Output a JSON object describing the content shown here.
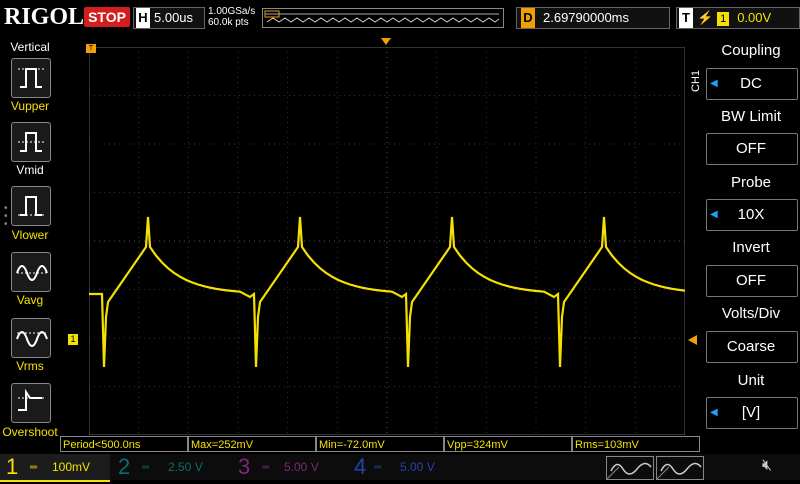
{
  "header": {
    "logo": "RIGOL",
    "status": "STOP",
    "horizontal_label": "H",
    "timebase": "5.00us",
    "sample_rate": "1.00GSa/s",
    "points": "60.0k pts",
    "delay_label": "D",
    "delay": "2.69790000ms",
    "trigger_label": "T",
    "trigger_edge_icon": "rising-edge-icon",
    "trigger_source": "1",
    "trigger_level": "0.00V"
  },
  "left_panel": {
    "title": "Vertical",
    "items": [
      {
        "label": "Vupper",
        "icon": "vupper-icon"
      },
      {
        "label": "Vmid",
        "icon": "vmid-icon"
      },
      {
        "label": "Vlower",
        "icon": "vlower-icon"
      },
      {
        "label": "Vavg",
        "icon": "vavg-icon"
      },
      {
        "label": "Vrms",
        "icon": "vrms-icon"
      },
      {
        "label": "Overshoot",
        "icon": "overshoot-icon"
      }
    ]
  },
  "right_panel": {
    "channel_tab": "CH1",
    "items": [
      {
        "title": "Coupling",
        "value": "DC",
        "has_arrow": true
      },
      {
        "title": "BW Limit",
        "value": "OFF",
        "has_arrow": false
      },
      {
        "title": "Probe",
        "value": "10X",
        "has_arrow": true
      },
      {
        "title": "Invert",
        "value": "OFF",
        "has_arrow": false
      },
      {
        "title": "Volts/Div",
        "value": "Coarse",
        "has_arrow": false
      },
      {
        "title": "Unit",
        "value": "[V]",
        "has_arrow": true
      }
    ]
  },
  "measurements": {
    "period": "Period<500.0ns",
    "max": "Max=252mV",
    "min": "Min=-72.0mV",
    "vpp": "Vpp=324mV",
    "rms": "Rms=103mV"
  },
  "channels": [
    {
      "num": "1",
      "scale": "100mV",
      "color": "#f5e100",
      "active": true
    },
    {
      "num": "2",
      "scale": "2.50 V",
      "color": "#00c8c8",
      "active": false
    },
    {
      "num": "3",
      "scale": "5.00 V",
      "color": "#d040d0",
      "active": false
    },
    {
      "num": "4",
      "scale": "5.00 V",
      "color": "#2a6cff",
      "active": false
    }
  ],
  "markers": {
    "trigger_pos": "T",
    "ch1_ground": "1"
  },
  "colors": {
    "ch1": "#f5e100",
    "accent": "#1aa3ff",
    "stop": "#d21e1e",
    "delay": "#f0a000"
  }
}
